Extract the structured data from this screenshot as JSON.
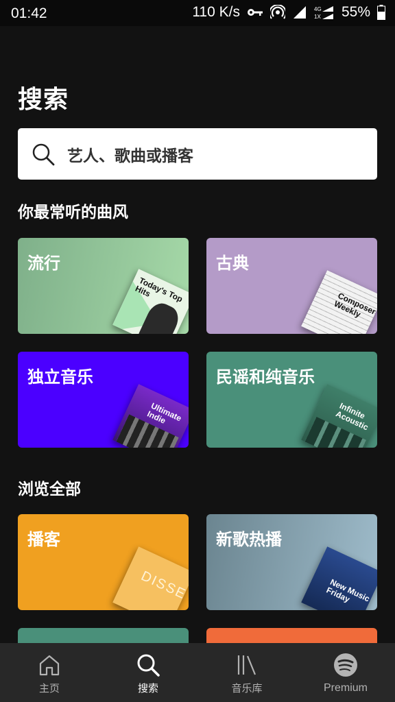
{
  "status_bar": {
    "time": "01:42",
    "net_speed": "110 K/s",
    "battery": "55%"
  },
  "header": {
    "title": "搜索"
  },
  "search": {
    "placeholder": "艺人、歌曲或播客"
  },
  "sections": {
    "favorite_genres_title": "你最常听的曲风",
    "browse_all_title": "浏览全部"
  },
  "genres": [
    {
      "label": "流行",
      "color": "#8dba8d",
      "cover_text": "Today's Top Hits"
    },
    {
      "label": "古典",
      "color": "#b49bc8",
      "cover_text": "Composer Weekly"
    },
    {
      "label": "独立音乐",
      "color": "#4b00ff",
      "cover_text": "Ultimate Indie"
    },
    {
      "label": "民谣和纯音乐",
      "color": "#4a907a",
      "cover_text": "Infinite Acoustic"
    }
  ],
  "browse": [
    {
      "label": "播客",
      "color": "#f0a020",
      "cover_text": "DISSECT"
    },
    {
      "label": "新歌热播",
      "color": "#8aa4b0",
      "cover_text": "New Music Friday"
    }
  ],
  "nav": [
    {
      "label": "主页",
      "icon": "home-icon"
    },
    {
      "label": "搜索",
      "icon": "search-icon"
    },
    {
      "label": "音乐库",
      "icon": "library-icon"
    },
    {
      "label": "Premium",
      "icon": "spotify-logo-icon"
    }
  ]
}
